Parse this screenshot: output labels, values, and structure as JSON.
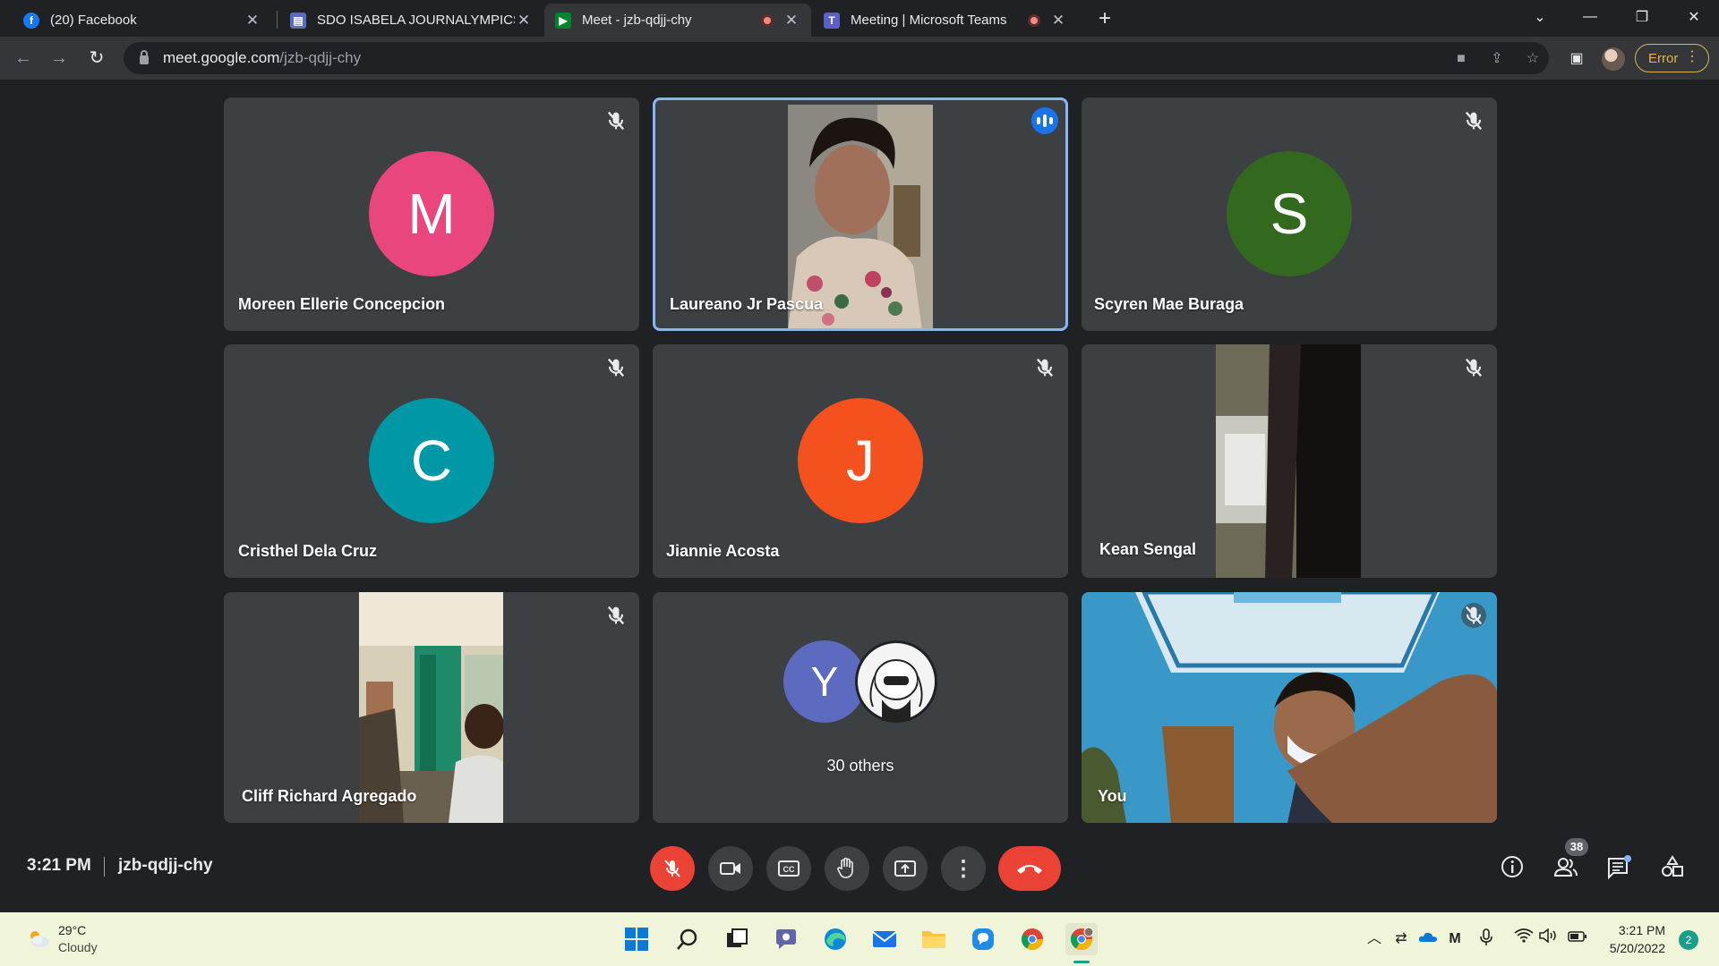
{
  "browser": {
    "tabs": [
      {
        "label": "(20) Facebook",
        "icon": "facebook-icon"
      },
      {
        "label": "SDO ISABELA JOURNALYMPICS -",
        "icon": "forms-icon"
      },
      {
        "label": "Meet - jzb-qdjj-chy",
        "icon": "meet-icon",
        "active": true
      },
      {
        "label": "Meeting | Microsoft Teams",
        "icon": "teams-icon"
      }
    ],
    "url_host": "meet.google.com",
    "url_path": "/jzb-qdjj-chy",
    "error_label": "Error"
  },
  "participants": [
    {
      "name": "Moreen Ellerie Concepcion",
      "initial": "M",
      "color": "#e8467c"
    },
    {
      "name": "Laureano Jr Pascua",
      "speaking": true
    },
    {
      "name": "Scyren Mae Buraga",
      "initial": "S",
      "color": "#33691e"
    },
    {
      "name": "Cristhel Dela Cruz",
      "initial": "C",
      "color": "#0097a7"
    },
    {
      "name": "Jiannie Acosta",
      "initial": "J",
      "color": "#f4511e"
    },
    {
      "name": "Kean Sengal"
    },
    {
      "name": "Cliff Richard Agregado"
    },
    {
      "name": "30 others",
      "initial": "Y",
      "color": "#5c6bc0"
    },
    {
      "name": "You"
    }
  ],
  "meeting": {
    "time": "3:21 PM",
    "code": "jzb-qdjj-chy",
    "people_count": "38"
  },
  "taskbar": {
    "temperature": "29°C",
    "condition": "Cloudy",
    "time": "3:21 PM",
    "date": "5/20/2022",
    "notifications": "2"
  }
}
